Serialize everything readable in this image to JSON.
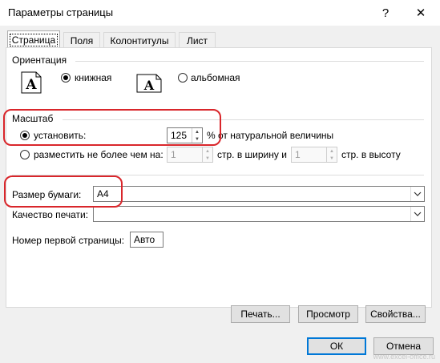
{
  "window": {
    "title": "Параметры страницы",
    "help_label": "?",
    "close_label": "✕"
  },
  "tabs": [
    {
      "label": "Страница",
      "active": true
    },
    {
      "label": "Поля",
      "active": false
    },
    {
      "label": "Колонтитулы",
      "active": false
    },
    {
      "label": "Лист",
      "active": false
    }
  ],
  "orientation": {
    "group_label": "Ориентация",
    "portrait_label": "книжная",
    "landscape_label": "альбомная",
    "icon_letter": "A",
    "selected": "portrait"
  },
  "scale": {
    "group_label": "Масштаб",
    "adjust_label": "установить:",
    "adjust_value": "125",
    "adjust_suffix": "% от натуральной величины",
    "fit_label": "разместить не более чем на:",
    "fit_wide_value": "1",
    "fit_wide_suffix": "стр. в ширину и",
    "fit_tall_value": "1",
    "fit_tall_suffix": "стр. в высоту",
    "selected": "adjust"
  },
  "paper": {
    "size_label": "Размер бумаги:",
    "size_value": "A4",
    "quality_label": "Качество печати:",
    "quality_value": "",
    "first_page_label": "Номер первой страницы:",
    "first_page_value": "Авто"
  },
  "buttons": {
    "print": "Печать...",
    "preview": "Просмотр",
    "properties": "Свойства...",
    "ok": "ОК",
    "cancel": "Отмена"
  },
  "colors": {
    "highlight": "#d9262b",
    "primary_border": "#0078d7"
  },
  "watermark": "www.excel-office.ru"
}
